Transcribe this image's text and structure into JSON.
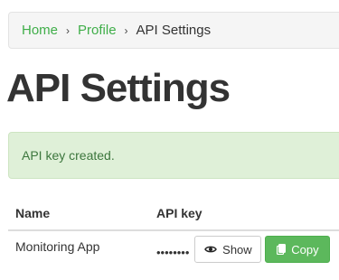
{
  "breadcrumb": {
    "items": [
      {
        "label": "Home"
      },
      {
        "label": "Profile"
      },
      {
        "label": "API Settings"
      }
    ],
    "separator": "›"
  },
  "page": {
    "title": "API Settings"
  },
  "alert": {
    "message": "API key created.",
    "type": "success"
  },
  "table": {
    "headers": [
      "Name",
      "API key"
    ],
    "rows": [
      {
        "name": "Monitoring App",
        "masked_key": "••••••••",
        "show_label": "Show",
        "copy_label": "Copy"
      }
    ]
  },
  "icons": {
    "show": "eye-icon",
    "copy": "copy-icon"
  },
  "colors": {
    "link": "#3fae49",
    "success_bg": "#dff0d8",
    "success_text": "#3c763d",
    "button_success": "#5cb85c"
  }
}
